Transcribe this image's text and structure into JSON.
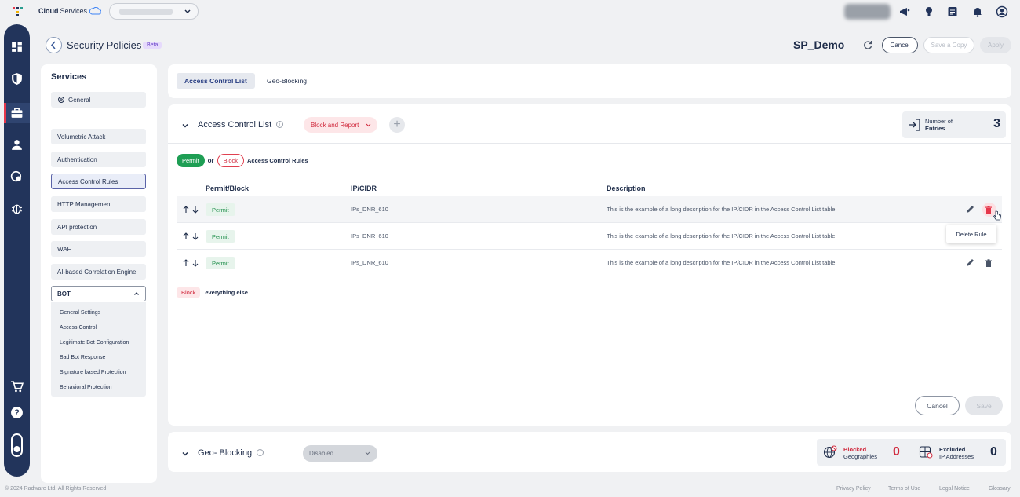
{
  "brand": {
    "name_bold": "Cloud",
    "name_rest": " Services"
  },
  "header": {
    "title": "Security Policies",
    "badge": "Beta",
    "policy_name": "SP_Demo",
    "cancel": "Cancel",
    "save_copy": "Save a Copy",
    "apply": "Apply"
  },
  "sidebar": {
    "title": "Services",
    "general": "General",
    "items": [
      "Volumetric Attack",
      "Authentication",
      "Access Control Rules",
      "HTTP Management",
      "API protection",
      "WAF",
      "AI-based Correlation Engine"
    ],
    "selected_item": "Access Control Rules",
    "bot": {
      "label": "BOT",
      "subitems": [
        "General Settings",
        "Access Control",
        "Legitimate Bot Configuration",
        "Bad Bot Response",
        "Signature based Protection",
        "Behavioral Protection"
      ]
    }
  },
  "tabs": {
    "active": "Access Control List",
    "other": "Geo-Blocking"
  },
  "acl": {
    "title": "Access Control List",
    "mode": "Block and Report",
    "entries_label_1": "Number of",
    "entries_label_2": "Entries",
    "entries_count": "3",
    "legend": {
      "permit": "Permit",
      "or": "or",
      "block": "Block",
      "suffix": "Access Control Rules"
    },
    "columns": {
      "action": "Permit/Block",
      "ip": "IP/CIDR",
      "description": "Description"
    },
    "rows": [
      {
        "action": "Permit",
        "ip": "IPs_DNR_610",
        "description": "This is the example of a long description for the IP/CIDR in the Access Control List table"
      },
      {
        "action": "Permit",
        "ip": "IPs_DNR_610",
        "description": "This is the example of a long description for the IP/CIDR in the Access Control List table"
      },
      {
        "action": "Permit",
        "ip": "IPs_DNR_610",
        "description": "This is the example of a long description for the IP/CIDR in the Access Control List table"
      }
    ],
    "tooltip": "Delete Rule",
    "default_action": "Block",
    "default_text": "everything else",
    "cancel": "Cancel",
    "save": "Save"
  },
  "geo": {
    "title": "Geo- Blocking",
    "status": "Disabled",
    "blocked_label_1": "Blocked",
    "blocked_label_2": "Geographies",
    "blocked_count": "0",
    "excluded_label_1": "Excluded",
    "excluded_label_2": "IP Addresses",
    "excluded_count": "0"
  },
  "footer": {
    "copyright": "© 2024 Radware Ltd. All Rights Reserved",
    "links": [
      "Privacy Policy",
      "Terms of Use",
      "Legal Notice",
      "Glossary"
    ]
  },
  "colors": {
    "navy": "#22345b",
    "accent_red": "#e5374b",
    "permit_green": "#1e9e54",
    "block_red": "#d0283c"
  }
}
